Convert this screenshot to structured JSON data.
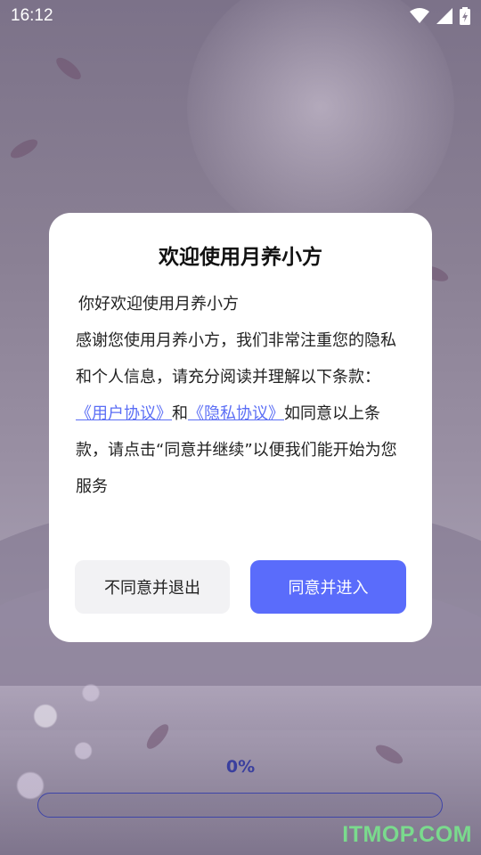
{
  "status_bar": {
    "time": "16:12",
    "icons": [
      "wifi-icon",
      "signal-icon",
      "battery-charging-icon"
    ]
  },
  "dialog": {
    "title": "欢迎使用月养小方",
    "greeting": "你好欢迎使用月养小方",
    "intro": "感谢您使用月养小方，我们非常注重您的隐私和个人信息，请充分阅读并理解以下条款：",
    "user_agreement_link": "《用户协议》",
    "and_text": "和",
    "privacy_link": "《隐私协议》",
    "consent_text": "如同意以上条款，请点击“同意并继续”以便我们能开始为您服务",
    "decline_label": "不同意并退出",
    "accept_label": "同意并进入"
  },
  "progress": {
    "label": "0%",
    "value": 0
  },
  "watermark": "ITMOP.COM",
  "colors": {
    "accent": "#5a6cfb",
    "link": "#5b6ef5",
    "progress_border": "#3e44a8"
  }
}
